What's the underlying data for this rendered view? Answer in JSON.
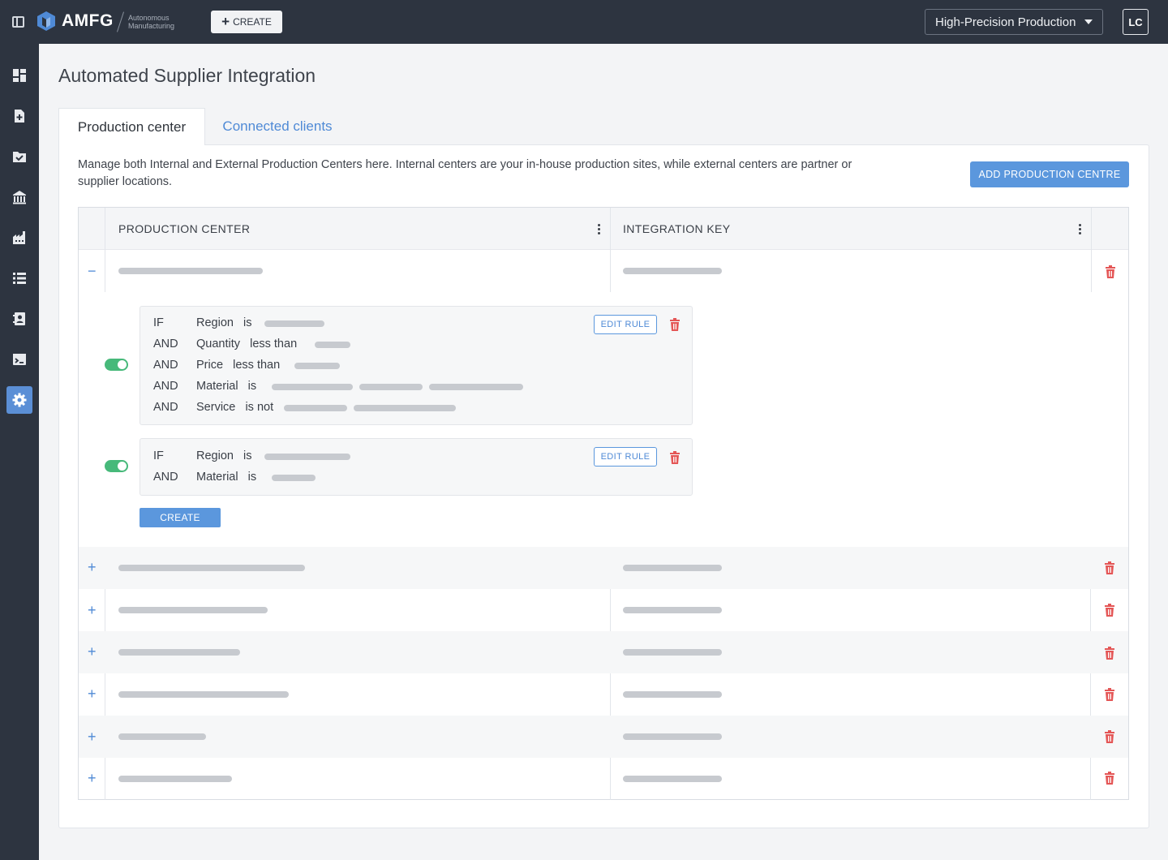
{
  "topbar": {
    "brand": "AMFG",
    "brand_sub": "Autonomous Manufacturing",
    "create_label": "CREATE",
    "workspace_select": "High-Precision Production",
    "avatar_initials": "LC"
  },
  "sidebar": {
    "items": [
      {
        "icon": "dashboard-icon"
      },
      {
        "icon": "new-order-icon"
      },
      {
        "icon": "folder-check-icon"
      },
      {
        "icon": "building-icon"
      },
      {
        "icon": "factory-icon"
      },
      {
        "icon": "list-icon"
      },
      {
        "icon": "contacts-icon"
      },
      {
        "icon": "terminal-icon"
      },
      {
        "icon": "gear-icon",
        "active": true
      }
    ]
  },
  "page": {
    "title": "Automated Supplier Integration",
    "tabs": [
      {
        "label": "Production center",
        "active": true
      },
      {
        "label": "Connected clients",
        "active": false
      }
    ],
    "description": "Manage both Internal and External Production Centers here. Internal centers are your in-house production sites, while external centers are partner or supplier locations.",
    "add_button": "ADD PRODUCTION CENTRE"
  },
  "table": {
    "columns": [
      "PRODUCTION CENTER",
      "INTEGRATION KEY"
    ],
    "expanded_row": {
      "expander": "−",
      "rules": [
        {
          "enabled": true,
          "edit_label": "EDIT RULE",
          "conditions": [
            {
              "keyword": "IF",
              "field": "Region",
              "operator": "is"
            },
            {
              "keyword": "AND",
              "field": "Quantity",
              "operator": "less than"
            },
            {
              "keyword": "AND",
              "field": "Price",
              "operator": "less than"
            },
            {
              "keyword": "AND",
              "field": "Material",
              "operator": "is"
            },
            {
              "keyword": "AND",
              "field": "Service",
              "operator": "is not"
            }
          ]
        },
        {
          "enabled": true,
          "edit_label": "EDIT RULE",
          "conditions": [
            {
              "keyword": "IF",
              "field": "Region",
              "operator": "is"
            },
            {
              "keyword": "AND",
              "field": "Material",
              "operator": "is"
            }
          ]
        }
      ],
      "create_label": "CREATE"
    },
    "collapsed_expander": "+",
    "accent_colors": {
      "primary": "#5b97dd",
      "danger": "#e45656",
      "toggle_on": "#47b97a"
    }
  }
}
